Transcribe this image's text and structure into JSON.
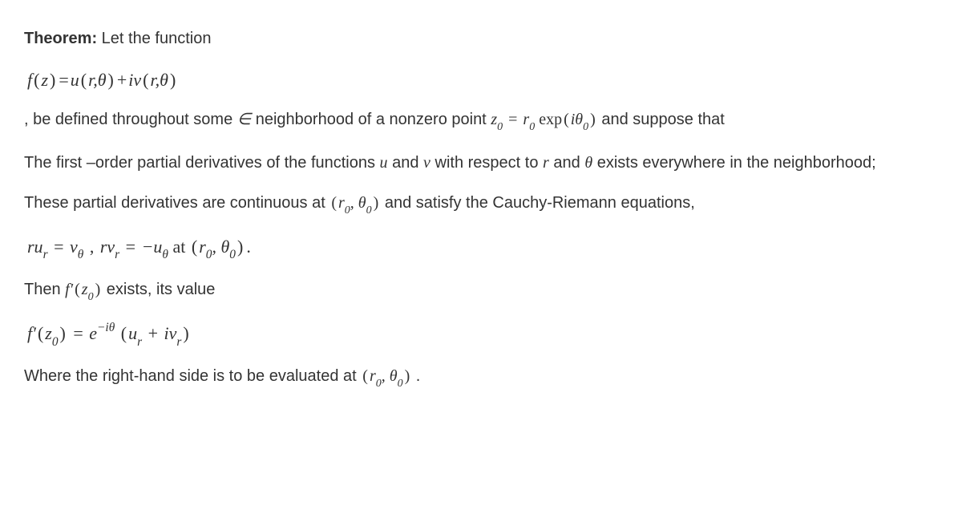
{
  "theorem": {
    "label": "Theorem:",
    "intro": " Let the function",
    "eq1_html": "<span class='math'>f<span class='op'>(</span>z<span class='op'>)</span><span class='op'>=</span>u<span class='op'>(</span>r,&theta;<span class='op'>)</span><span class='op'>+</span>iv<span class='op'>(</span>r,&theta;<span class='op'>)</span></span>",
    "line2_prefix": ", be defined throughout some ",
    "eps_html": "<span class='math'>&isin;</span>",
    "line2_mid": " neighborhood of a nonzero point ",
    "z0_expr_html": "<span class='math'>z<span class='sub'>0</span> <span class='op'>=</span> r<span class='sub'>0</span> <span class='rm'>exp</span><span class='op'>(</span>i&theta;<span class='sub'>0</span><span class='op'>)</span></span>",
    "line2_suffix": " and suppose that",
    "line3_a": "The first –order partial derivatives of the functions ",
    "u_html": "<span class='math'>u</span>",
    "line3_b": " and ",
    "v_html": "<span class='math'>v</span>",
    "line3_c": " with respect to ",
    "r_html": "<span class='math'>r</span>",
    "line3_d": " and ",
    "theta_html": "<span class='math'>&theta;</span>",
    "line3_e": " exists everywhere in the neighborhood;",
    "line4_a": "These partial derivatives are continuous at ",
    "r0theta0_html": "<span class='math'><span class='op'>(</span>r<span class='sub'>0</span>, &theta;<span class='sub'>0</span><span class='op'>)</span></span>",
    "line4_b": " and satisfy the Cauchy-Riemann equations,",
    "eq2_html": "<span class='math'>ru<span class='sub'>r</span> <span class='op'>=</span> v<span class='sub'>&theta;</span></span> <span class='op'>,</span> <span class='math'>rv<span class='sub'>r</span> <span class='op'>=</span> &minus;u<span class='sub'>&theta;</span></span> <span style='font-style:normal'>at</span> <span class='math'><span class='op'>(</span>r<span class='sub'>0</span>, &theta;<span class='sub'>0</span><span class='op'>)</span></span><span class='op'>.</span>",
    "line5_a": "Then ",
    "fprime_z0_html": "<span class='math'>f&prime;<span class='op'>(</span>z<span class='sub'>0</span><span class='op'>)</span></span>",
    "line5_b": " exists, its value",
    "eq3_html": "<span class='math'>f&prime;<span class='op'>(</span>z<span class='sub'>0</span><span class='op'>)</span> <span class='op'>=</span> e<span class='sup'>&minus;i&theta;</span> <span class='op'>(</span>u<span class='sub'>r</span> <span class='op'>+</span> iv<span class='sub'>r</span><span class='op'>)</span></span>",
    "line6_a": "Where the right-hand side is to be evaluated at ",
    "line6_b": "."
  }
}
